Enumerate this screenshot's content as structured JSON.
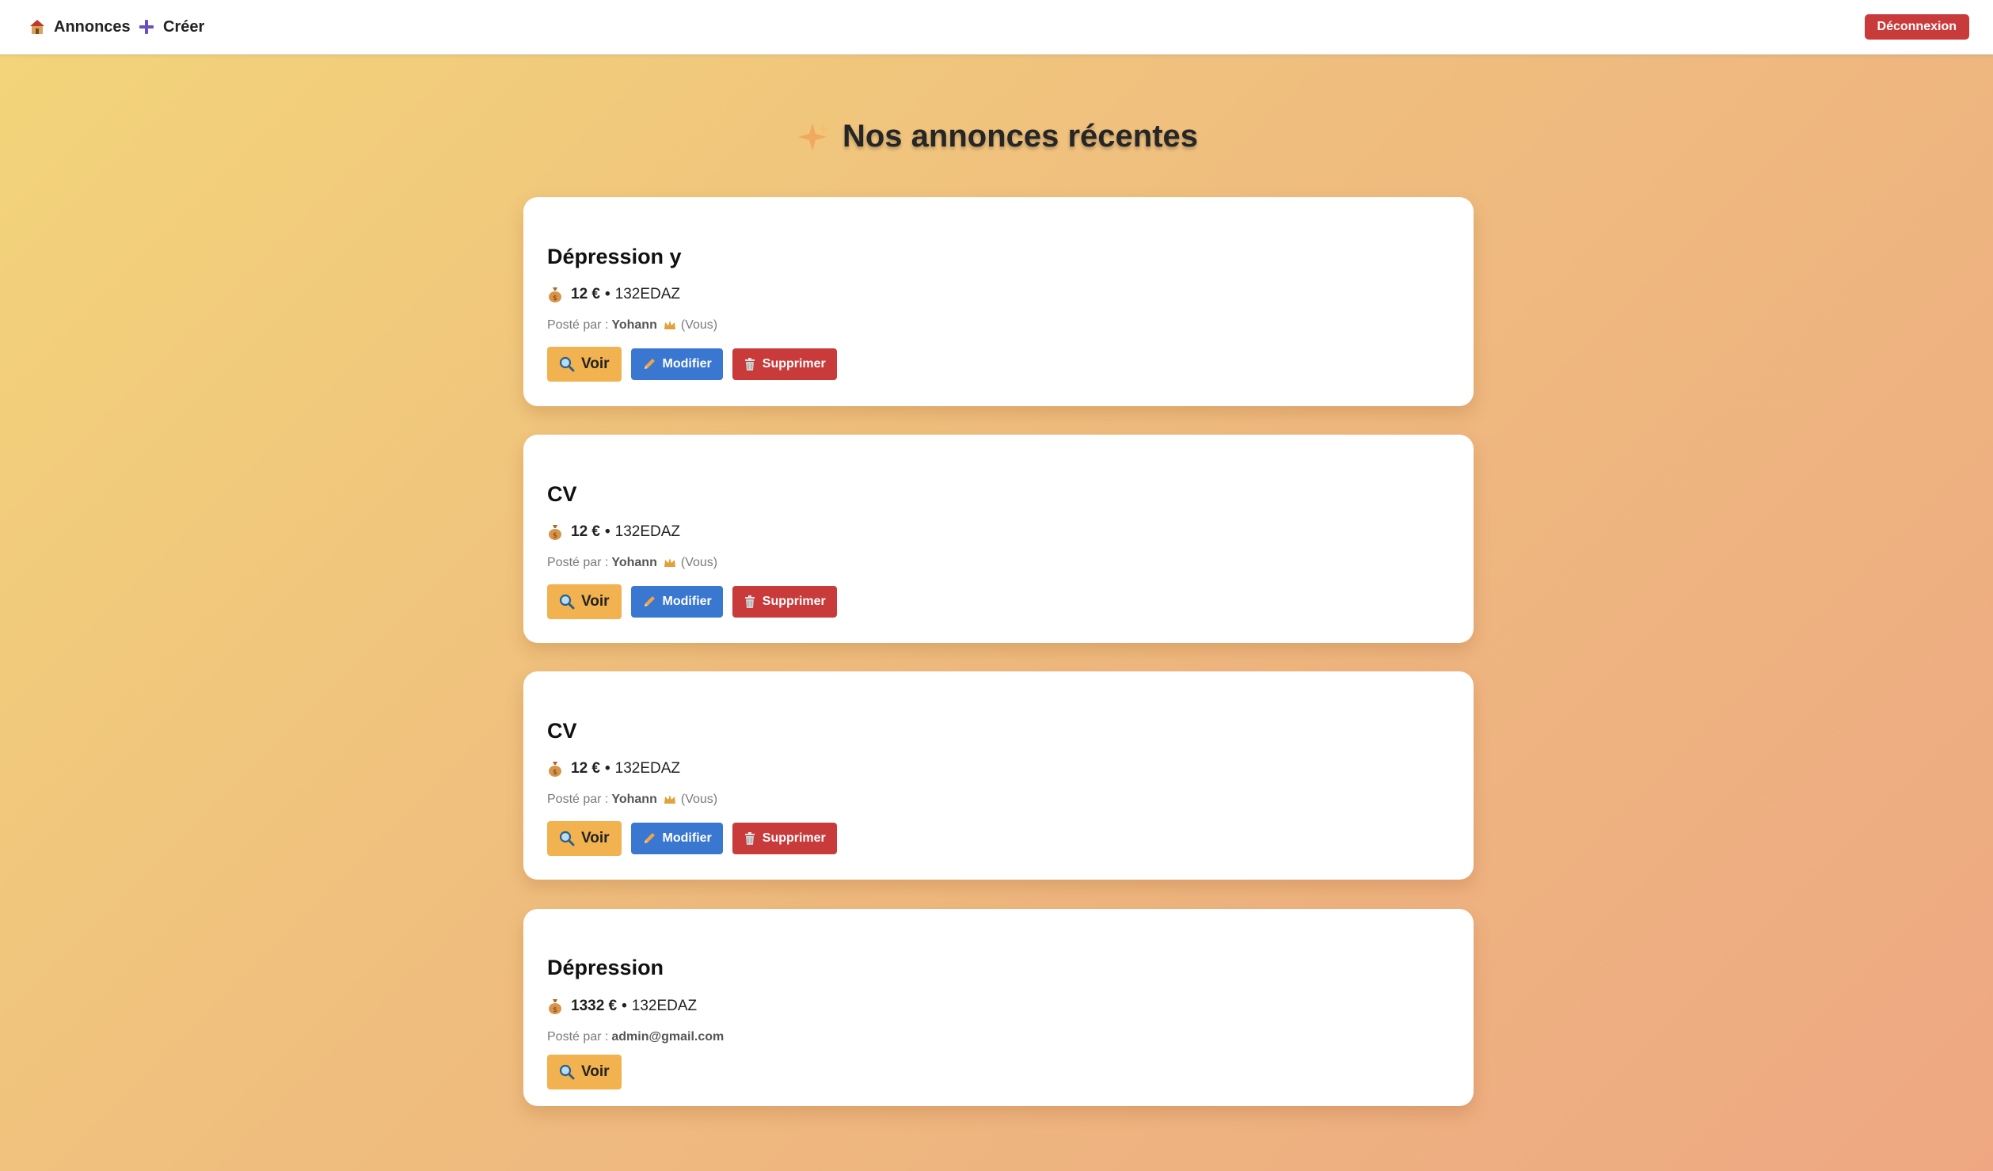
{
  "nav": {
    "annonces_label": "Annonces",
    "creer_label": "Créer",
    "logout_label": "Déconnexion"
  },
  "page": {
    "title": "Nos annonces récentes"
  },
  "posted_by_label": "Posté par :",
  "you_label": "(Vous)",
  "currency": "€",
  "buttons": {
    "voir": "Voir",
    "modifier": "Modifier",
    "supprimer": "Supprimer"
  },
  "listings": [
    {
      "title": "Dépression y",
      "price": "12 €",
      "code": "132EDAZ",
      "author": "Yohann",
      "is_own": true
    },
    {
      "title": "CV",
      "price": "12 €",
      "code": "132EDAZ",
      "author": "Yohann",
      "is_own": true
    },
    {
      "title": "CV",
      "price": "12 €",
      "code": "132EDAZ",
      "author": "Yohann",
      "is_own": true
    },
    {
      "title": "Dépression",
      "price": "1332 €",
      "code": "132EDAZ",
      "author": "admin@gmail.com",
      "is_own": false
    }
  ],
  "colors": {
    "voir_button": "#f1b24f",
    "modifier_button": "#3a77d0",
    "supprimer_button": "#c93b3b",
    "logout_button": "#c93b3b"
  },
  "icons": {
    "annonces": "house-icon",
    "creer": "plus-icon",
    "title": "sparkles-icon",
    "price": "money-bag-icon",
    "owner": "crown-icon",
    "voir": "magnifier-icon",
    "modifier": "pencil-icon",
    "supprimer": "trash-icon"
  }
}
